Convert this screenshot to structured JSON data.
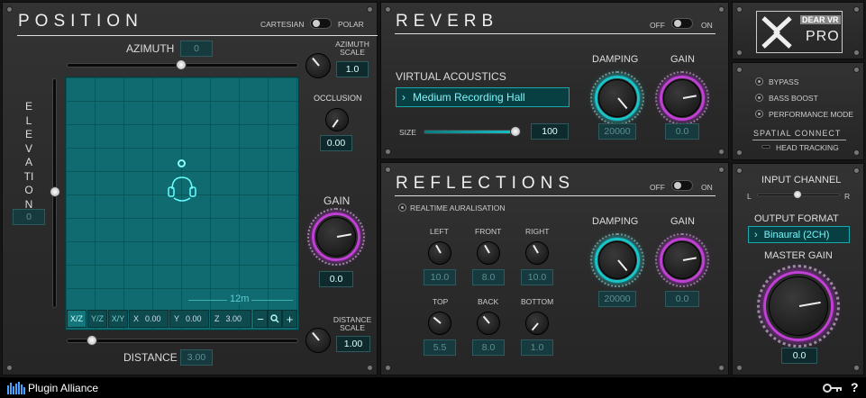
{
  "position": {
    "title": "POSITION",
    "cartesian": "CARTESIAN",
    "polar": "POLAR",
    "azimuth_label": "AZIMUTH",
    "azimuth_value": "0",
    "azimuth_scale_label": "AZIMUTH\nSCALE",
    "azimuth_scale_value": "1.0",
    "elevation_label": "ELEVATION",
    "elevation_value": "0",
    "occlusion_label": "OCCLUSION",
    "occlusion_value": "0.00",
    "gain_label": "GAIN",
    "gain_value": "0.0",
    "distance_label": "DISTANCE",
    "distance_value": "3.00",
    "distance_scale_label": "DISTANCE\nSCALE",
    "distance_scale_value": "1.00",
    "grid_scale": "12m",
    "toolbar": {
      "xz": "X/Z",
      "yz": "Y/Z",
      "xy": "X/Y",
      "x_label": "X",
      "x_value": "0.00",
      "y_label": "Y",
      "y_value": "0.00",
      "z_label": "Z",
      "z_value": "3.00",
      "minus": "−",
      "plus": "+"
    }
  },
  "reverb": {
    "title": "REVERB",
    "off": "OFF",
    "on": "ON",
    "virtual_acoustics": "VIRTUAL ACOUSTICS",
    "preset": "Medium Recording Hall",
    "size_label": "SIZE",
    "size_value": "100",
    "damping_label": "DAMPING",
    "damping_value": "20000",
    "gain_label": "GAIN",
    "gain_value": "0.0"
  },
  "reflections": {
    "title": "REFLECTIONS",
    "off": "OFF",
    "on": "ON",
    "realtime": "REALTIME AURALISATION",
    "walls": [
      {
        "label": "LEFT",
        "value": "10.0"
      },
      {
        "label": "FRONT",
        "value": "8.0"
      },
      {
        "label": "RIGHT",
        "value": "10.0"
      },
      {
        "label": "TOP",
        "value": "5.5"
      },
      {
        "label": "BACK",
        "value": "8.0"
      },
      {
        "label": "BOTTOM",
        "value": "1.0"
      }
    ],
    "damping_label": "DAMPING",
    "damping_value": "20000",
    "gain_label": "GAIN",
    "gain_value": "0.0"
  },
  "logo": {
    "brand": "DEAR VR",
    "edition": "PRO"
  },
  "options": {
    "bypass": "BYPASS",
    "bass_boost": "BASS BOOST",
    "performance_mode": "PERFORMANCE MODE",
    "spatial_connect": "SPATIAL CONNECT",
    "head_tracking": "HEAD TRACKING"
  },
  "output": {
    "input_channel": "INPUT CHANNEL",
    "l": "L",
    "r": "R",
    "output_format_label": "OUTPUT FORMAT",
    "output_format": "Binaural (2CH)",
    "master_gain_label": "MASTER GAIN",
    "master_gain_value": "0.0"
  },
  "footer": {
    "brand": "Plugin Alliance",
    "help": "?"
  },
  "colors": {
    "accent": "#19c4c9",
    "purple": "#c23fd6",
    "grid": "#0f6b6f"
  }
}
